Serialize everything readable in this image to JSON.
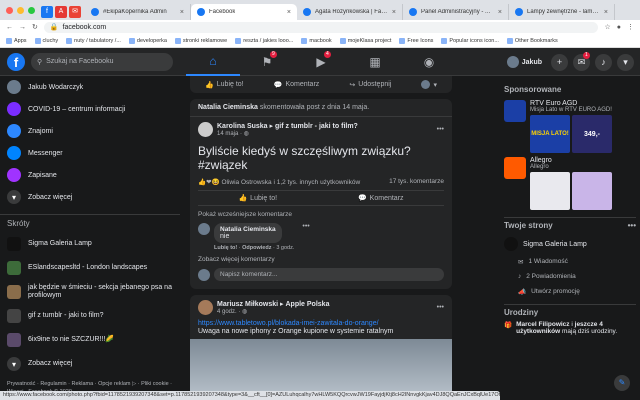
{
  "browser": {
    "pinned": [
      {
        "label": "f",
        "color": "#1877f2"
      },
      {
        "label": "A",
        "color": "#e53935"
      },
      {
        "label": "✉",
        "color": "#ea4335"
      }
    ],
    "tabs": [
      {
        "title": "#EkipaKopernika Admin",
        "active": false
      },
      {
        "title": "Facebook",
        "active": true
      },
      {
        "title": "Agata Rozynkowska | Faceboo...",
        "active": false
      },
      {
        "title": "Panel Administracyjny - Aktyw...",
        "active": false
      },
      {
        "title": "Lampy zewnętrzne - lampypol...",
        "active": false
      }
    ],
    "url": "facebook.com",
    "bookmarks": [
      "Apps",
      "cluchy",
      "nuty / tabulatory /...",
      "developerka",
      "stronki reklamowe",
      "reszta / jakies looo...",
      "macbook",
      "mojeKlasa project",
      "Free Icons",
      "Popular icons icon...",
      "Other Bookmarks"
    ],
    "status_url": "https://www.facebook.com/photo.php?fbid=1178521939207348&set=p.1178521939207348&type=3&__cft__[0]=AZULuhqcalhy7wHLW5KQQrcvwJW19FayjdjKtj8cH2INnvgkKjav4DJ8QQaEnJCxBqlUe17Or2-5oIKNoLOqo8XuA4RJXqUSTZAhWh..."
  },
  "fb": {
    "search_placeholder": "Szukaj na Facebooku",
    "nav_badges": {
      "pages": "9",
      "watch": "4"
    },
    "user_name": "Jakub",
    "messenger_badge": "1",
    "left_items": [
      {
        "label": "Jakub Wodarczyk",
        "icon": "avatar",
        "color": "#6b7b8c"
      },
      {
        "label": "COVID-19 – centrum informacji",
        "icon": "covid-icon",
        "color": "#7b2dff"
      },
      {
        "label": "Znajomi",
        "icon": "friends-icon",
        "color": "#2d88ff"
      },
      {
        "label": "Messenger",
        "icon": "messenger-icon",
        "color": "#0084ff"
      },
      {
        "label": "Zapisane",
        "icon": "saved-icon",
        "color": "#a033ff"
      },
      {
        "label": "Zobacz więcej",
        "icon": "chevron-down-icon",
        "color": "#3a3b3c"
      }
    ],
    "shortcuts_title": "Skróty",
    "shortcuts": [
      {
        "label": "Sigma Galeria Lamp",
        "color": "#111"
      },
      {
        "label": "ESlandscapesltd - London landscapes",
        "color": "#3d6b3a"
      },
      {
        "label": "jak będzie w śmieciu - sekcja jebanego psa na profilowym",
        "color": "#8a6d4b"
      },
      {
        "label": "gif z tumblr - jaki to film?",
        "color": "#444"
      },
      {
        "label": "6ix9ine to nie SZCZUR!!!🌽",
        "color": "#5a4a6a"
      },
      {
        "label": "Zobacz więcej",
        "color": "#3a3b3c"
      }
    ],
    "footer": "Prywatność · Regulamin · Reklama · Opcje reklam ▷ · Pliki cookie · Więcej · Facebook © 2020"
  },
  "feed": {
    "top_actions": {
      "like": "Lubię to!",
      "comment": "Komentarz",
      "share": "Udostępnij"
    },
    "post1": {
      "context_name": "Natalia Cieminska",
      "context_text": "skomentowała post z dnia 14 maja.",
      "author": "Karolina Suska",
      "group": "gif z tumblr - jaki to film?",
      "date": "14 maja",
      "text_line1": "Byliście kiedyś w szczęśliwym związku?",
      "text_line2": "#związek",
      "reactions": "Oliwia Ostrowska i 1,2 tys. innych użytkowników",
      "comments_count": "17 tys. komentarze",
      "like": "Lubię to!",
      "comment": "Komentarz",
      "prev_comments": "Pokaż wcześniejsze komentarze",
      "commenter": "Natalia Cieminska",
      "comment_text": "nie",
      "c_like": "Lubię to!",
      "c_reply": "Odpowiedz",
      "c_time": "3 godz.",
      "more_comments": "Zobacz więcej komentarzy",
      "write_placeholder": "Napisz komentarz..."
    },
    "post2": {
      "author": "Mariusz Miłkowski",
      "page": "Apple Polska",
      "time": "4 godz.",
      "link": "https://www.tabletowo.pl/blokada-imei-zawitala-do-orange/",
      "text": "Uwaga na nowe iphony z Orange kupione w systemie ratalnym"
    }
  },
  "right": {
    "sponsored_title": "Sponsorowane",
    "ads": [
      {
        "name": "RTV Euro AGD",
        "desc": "Misja Lato w RTV EURO AGD!",
        "banner": "MISJA LATO!",
        "price": "349,-",
        "color": "#1b3fa6"
      },
      {
        "name": "Allegro",
        "desc": "Allegro",
        "color": "#ff5a00"
      }
    ],
    "pages_title": "Twoje strony",
    "page_name": "Sigma Galeria Lamp",
    "page_items": [
      {
        "label": "1 Wiadomość"
      },
      {
        "label": "2 Powiadomienia"
      },
      {
        "label": "Utwórz promocję"
      }
    ],
    "birthdays_title": "Urodziny",
    "birthday_name1": "Marcel Filipowicz",
    "birthday_and": "i",
    "birthday_name2": "jeszcze 4 użytkowników",
    "birthday_suffix": "mają",
    "birthday_today": "dziś urodziny."
  }
}
